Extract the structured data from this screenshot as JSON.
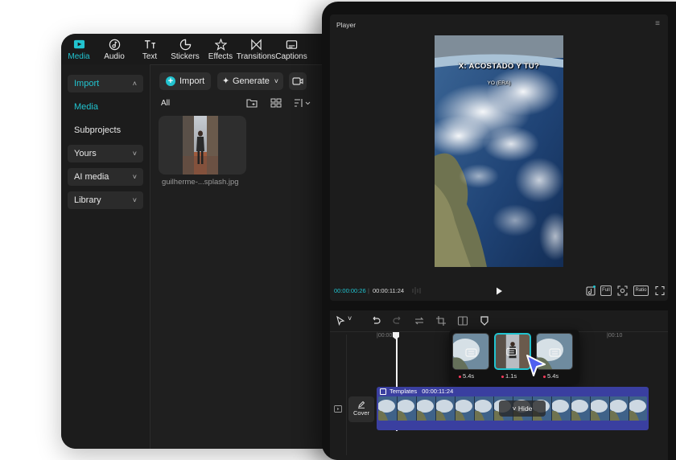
{
  "top_toolbar": {
    "tabs": [
      {
        "label": "Media",
        "icon": "media-icon",
        "active": true
      },
      {
        "label": "Audio",
        "icon": "audio-icon"
      },
      {
        "label": "Text",
        "icon": "text-icon"
      },
      {
        "label": "Stickers",
        "icon": "stickers-icon"
      },
      {
        "label": "Effects",
        "icon": "effects-icon"
      },
      {
        "label": "Transitions",
        "icon": "transitions-icon"
      },
      {
        "label": "Captions",
        "icon": "captions-icon"
      }
    ]
  },
  "left_panel": {
    "items": [
      {
        "label": "Import",
        "expanded": true
      },
      {
        "label": "Media",
        "selected": true
      },
      {
        "label": "Subprojects"
      },
      {
        "label": "Yours"
      },
      {
        "label": "AI media"
      },
      {
        "label": "Library"
      }
    ]
  },
  "media": {
    "import_label": "Import",
    "generate_label": "Generate",
    "filter_label": "All",
    "files": [
      {
        "name": "guilherme-...splash.jpg"
      }
    ]
  },
  "player": {
    "title": "Player",
    "caption_line1": "X: ACOSTADO Y TU?",
    "caption_line2": "YO (ERA)",
    "time_current": "00:00:00:26",
    "time_separator": "|",
    "time_total": "00:00:11:24",
    "full_label": "Full",
    "ratio_label": "Ratio"
  },
  "timeline": {
    "ruler_labels": [
      "|00:00",
      "|00:10"
    ],
    "popup_clips": [
      {
        "duration": "5.4s"
      },
      {
        "duration": "1.1s",
        "selected": true
      },
      {
        "duration": "5.4s"
      }
    ],
    "cover_label": "Cover",
    "track_label": "Templates",
    "track_duration": "00:00:11:24",
    "hide_label": "Hide"
  },
  "colors": {
    "accent": "#21c3cf",
    "track": "#3a3fa0",
    "cursor": "#4f5ff0",
    "panel": "#1c1c1c"
  }
}
